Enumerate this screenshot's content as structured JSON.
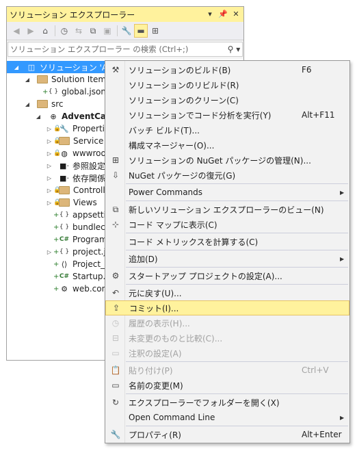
{
  "window": {
    "title": "ソリューション エクスプローラー",
    "pin_icon": "pin-icon",
    "close_icon": "close-icon"
  },
  "search": {
    "placeholder": "ソリューション エクスプローラー の検索 (Ctrl+;)"
  },
  "tree": [
    {
      "label": "ソリューション 'AdventC",
      "icon": "solution-icon",
      "level": 0,
      "expander": "open",
      "selected": true
    },
    {
      "label": "Solution Items",
      "icon": "folder-icon",
      "level": 1,
      "expander": "open"
    },
    {
      "label": "global.json",
      "icon": "json-file-icon",
      "level": 2
    },
    {
      "label": "src",
      "icon": "folder-icon",
      "level": 1,
      "expander": "open"
    },
    {
      "label": "AdventCalend",
      "icon": "web-project-icon",
      "level": 2,
      "expander": "open",
      "bold": true
    },
    {
      "label": "Properties",
      "icon": "wrench-icon",
      "level": 3,
      "expander": "closed"
    },
    {
      "label": "Service Ref",
      "icon": "folder-icon",
      "level": 3,
      "expander": "closed"
    },
    {
      "label": "wwwroot",
      "icon": "globe-icon",
      "level": 3,
      "expander": "closed"
    },
    {
      "label": "参照設定",
      "icon": "references-icon",
      "level": 3,
      "expander": "closed"
    },
    {
      "label": "依存関係",
      "icon": "dependencies-icon",
      "level": 3,
      "expander": "closed"
    },
    {
      "label": "Controllers",
      "icon": "folder-icon",
      "level": 3,
      "expander": "closed"
    },
    {
      "label": "Views",
      "icon": "folder-icon",
      "level": 3,
      "expander": "closed"
    },
    {
      "label": "appsetting",
      "icon": "json-file-icon",
      "level": 3
    },
    {
      "label": "bundlecon",
      "icon": "json-file-icon",
      "level": 3
    },
    {
      "label": "Program.c",
      "icon": "csharp-file-icon",
      "level": 3
    },
    {
      "label": "project.jso",
      "icon": "json-file-icon",
      "level": 3,
      "expander": "closed"
    },
    {
      "label": "Project_Re",
      "icon": "readme-file-icon",
      "level": 3
    },
    {
      "label": "Startup.cs",
      "icon": "csharp-file-icon",
      "level": 3
    },
    {
      "label": "web.config",
      "icon": "config-file-icon",
      "level": 3
    }
  ],
  "menu": [
    {
      "label": "ソリューションのビルド(B)",
      "shortcut": "F6",
      "icon": "build-icon"
    },
    {
      "label": "ソリューションのリビルド(R)"
    },
    {
      "label": "ソリューションのクリーン(C)"
    },
    {
      "label": "ソリューションでコード分析を実行(Y)",
      "shortcut": "Alt+F11"
    },
    {
      "label": "バッチ ビルド(T)..."
    },
    {
      "label": "構成マネージャー(O)..."
    },
    {
      "label": "ソリューションの NuGet パッケージの管理(N)...",
      "icon": "nuget-icon"
    },
    {
      "label": "NuGet パッケージの復元(G)",
      "icon": "restore-packages-icon"
    },
    {
      "sep": true
    },
    {
      "label": "Power Commands",
      "submenu": true
    },
    {
      "sep": true
    },
    {
      "label": "新しいソリューション エクスプローラーのビュー(N)",
      "icon": "new-view-icon"
    },
    {
      "label": "コード マップに表示(C)",
      "icon": "code-map-icon"
    },
    {
      "sep": true
    },
    {
      "label": "コード メトリックスを計算する(C)"
    },
    {
      "sep": true
    },
    {
      "label": "追加(D)",
      "submenu": true
    },
    {
      "sep": true
    },
    {
      "label": "スタートアップ プロジェクトの設定(A)...",
      "icon": "gear-icon"
    },
    {
      "sep": true
    },
    {
      "label": "元に戻す(U)...",
      "icon": "undo-icon"
    },
    {
      "label": "コミット(I)...",
      "icon": "commit-icon",
      "highlighted": true
    },
    {
      "label": "履歴の表示(H)...",
      "icon": "history-icon",
      "disabled": true
    },
    {
      "label": "未変更のものと比較(C)...",
      "icon": "compare-icon",
      "disabled": true
    },
    {
      "label": "注釈の設定(A)",
      "icon": "annotate-icon",
      "disabled": true
    },
    {
      "sep": true
    },
    {
      "label": "貼り付け(P)",
      "shortcut": "Ctrl+V",
      "icon": "paste-icon",
      "disabled": true
    },
    {
      "label": "名前の変更(M)",
      "icon": "rename-icon"
    },
    {
      "sep": true
    },
    {
      "label": "エクスプローラーでフォルダーを開く(X)",
      "icon": "open-folder-icon"
    },
    {
      "label": "Open Command Line",
      "submenu": true
    },
    {
      "sep": true
    },
    {
      "label": "プロパティ(R)",
      "shortcut": "Alt+Enter",
      "icon": "wrench-icon"
    }
  ]
}
